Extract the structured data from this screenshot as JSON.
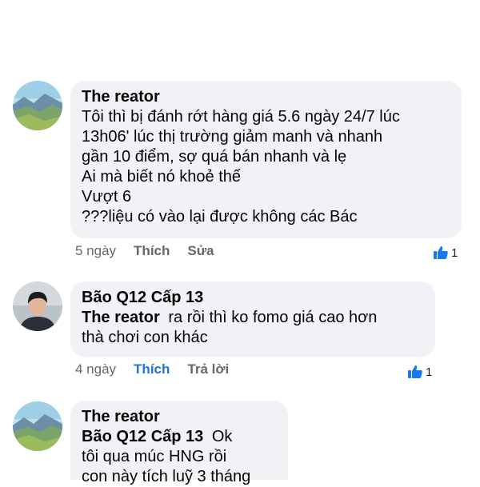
{
  "comments": [
    {
      "author": "The reator",
      "lines": [
        "Tôi thì bị đánh rớt hàng giá 5.6 ngày 24/7 lúc",
        "13h06' lúc thị trường giảm manh và nhanh",
        "gần 10 điểm, sợ quá bán nhanh và lẹ",
        "Ai mà biết nó khoẻ thế",
        "Vượt 6",
        "???liệu có vào lại được không các Bác"
      ],
      "time": "5 ngày",
      "like_label": "Thích",
      "action_label": "Sửa",
      "like_count": "1",
      "avatar_icon": "landscape-avatar-icon"
    },
    {
      "author": "Bão Q12 Cấp 13",
      "mention": "The reator",
      "first_line_rest": "ra rồi thì ko fomo giá cao hơn",
      "lines": [
        "thà chơi con khác"
      ],
      "time": "4 ngày",
      "like_label": "Thích",
      "action_label": "Trả lời",
      "like_count": "1",
      "like_active_color": "#1b74e4",
      "avatar_icon": "person-avatar-icon"
    },
    {
      "author": "The reator",
      "mention": "Bão Q12 Cấp 13",
      "first_line_rest": "Ok",
      "lines": [
        "tôi qua múc HNG rồi",
        "con này tích luỹ 3 tháng"
      ],
      "avatar_icon": "landscape-avatar-icon"
    }
  ],
  "colors": {
    "bubble": "#f0f2f5",
    "muted": "#65676b",
    "accent": "#1b74e4"
  }
}
